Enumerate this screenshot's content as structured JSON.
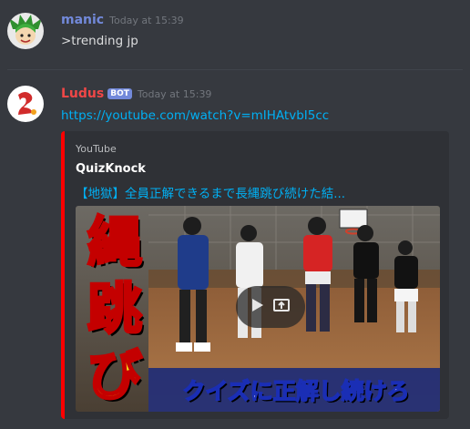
{
  "messages": [
    {
      "username": "manic",
      "username_color": "#7289da",
      "timestamp": "Today at 15:39",
      "text": ">trending jp"
    },
    {
      "username": "Ludus",
      "username_color": "#f04747",
      "bot_badge": "BOT",
      "timestamp": "Today at 15:39",
      "link": "https://youtube.com/watch?v=mIHAtvbI5cc",
      "embed": {
        "provider": "YouTube",
        "author": "QuizKnock",
        "title": "【地獄】全員正解できるまで長縄跳び続けた結...",
        "accent_color": "#ff0000",
        "thumbnail": {
          "side_text": [
            "縄",
            "跳",
            "び"
          ],
          "caption": "クイズに正解し続けろ"
        }
      }
    }
  ],
  "icons": [
    "play-icon",
    "share-icon"
  ]
}
